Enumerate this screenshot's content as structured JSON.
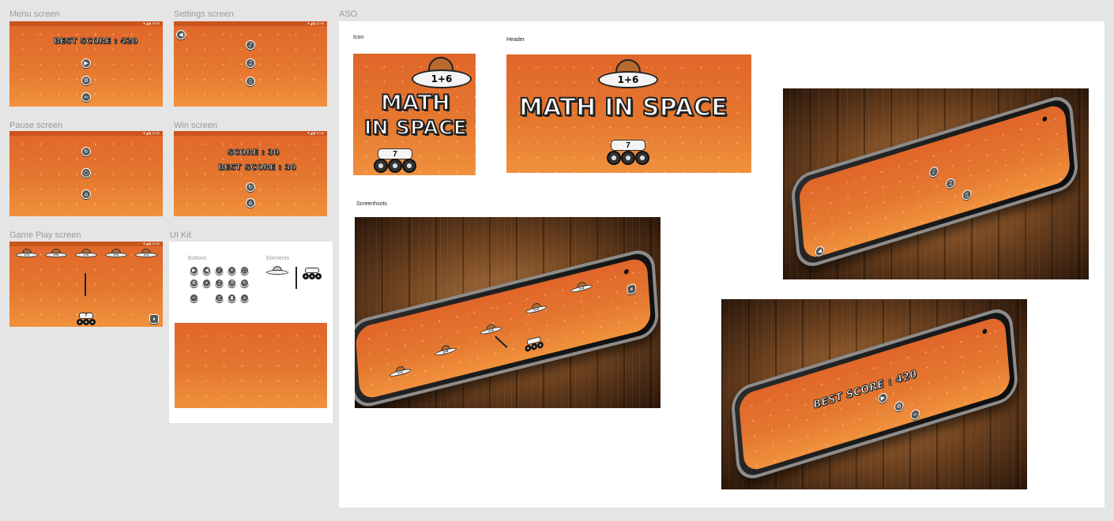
{
  "labels": {
    "menu": "Menu screen",
    "settings": "Settings screen",
    "pause": "Pause screen",
    "win": "Win screen",
    "gameplay": "Game Play screen",
    "uikit": "UI Kit",
    "aso": "ASO"
  },
  "statusbar": {
    "time": "▼◢ ▮ 12:30"
  },
  "menu": {
    "best_score": "BEST SCORE : 420",
    "buttons": [
      {
        "icon": "play-icon"
      },
      {
        "icon": "gear-icon"
      },
      {
        "icon": "exit-icon"
      }
    ]
  },
  "settings": {
    "back_icon": "back-arrow-icon",
    "buttons": [
      {
        "icon": "sound-icon"
      },
      {
        "icon": "music-icon"
      },
      {
        "icon": "vibration-icon"
      }
    ]
  },
  "pause": {
    "buttons": [
      {
        "icon": "restart-icon"
      },
      {
        "icon": "resume-icon"
      },
      {
        "icon": "home-icon"
      }
    ]
  },
  "win": {
    "score": "SCORE : 30",
    "best_score": "BEST SCORE : 30",
    "buttons": [
      {
        "icon": "restart-icon"
      },
      {
        "icon": "home-icon"
      }
    ]
  },
  "gameplay": {
    "ufos": [
      "1+1",
      "2+6",
      "1+6",
      "2+2",
      "1+2"
    ],
    "rover_value": "7",
    "pause_icon": "pause-icon"
  },
  "uikit": {
    "buttons_label": "Buttons",
    "elements_label": "Elements"
  },
  "aso": {
    "icon_label": "Icon",
    "header_label": "Header",
    "screenshots_label": "Screenhsots",
    "icon_title_line1": "MATH",
    "icon_title_line2": "IN SPACE",
    "header_title": "MATH IN SPACE",
    "ufo_equation": "1+6",
    "rover_value": "7",
    "screenshot_ufos": [
      "1+1",
      "2+6",
      "1+6",
      "2+2",
      "1+2"
    ],
    "screenshot_best_score": "BEST SCORE : 420"
  },
  "colors": {
    "orange_top": "#e0662a",
    "orange_bottom": "#f0913d",
    "button_dark": "#555555",
    "canvas": "#e5e5e5"
  }
}
